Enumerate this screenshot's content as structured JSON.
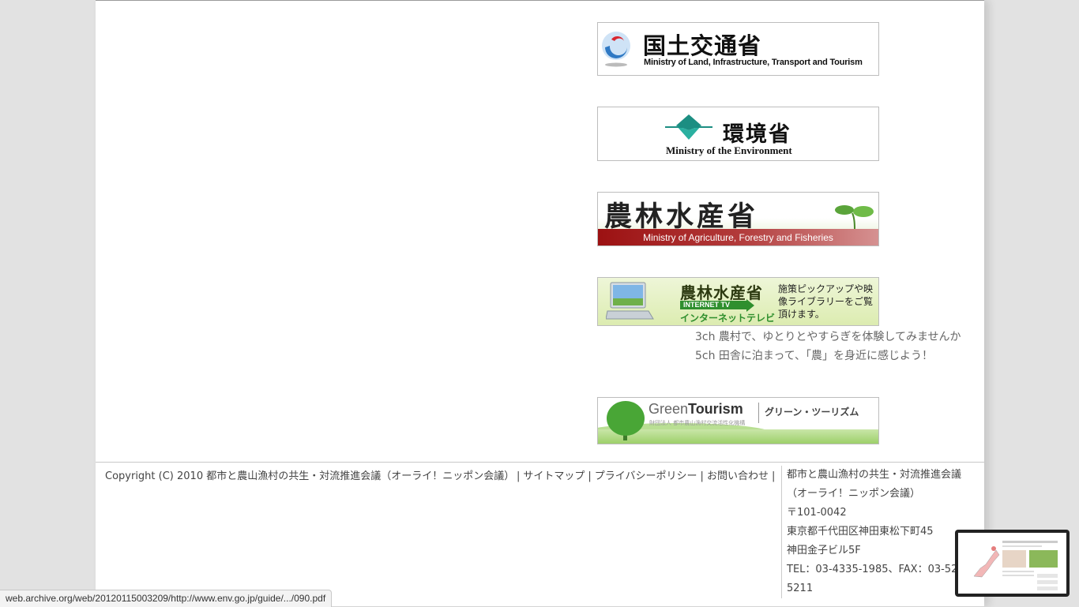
{
  "banners": {
    "mlit": {
      "jp": "国土交通省",
      "en": "Ministry of Land, Infrastructure, Transport and Tourism"
    },
    "env": {
      "jp": "環境省",
      "en": "Ministry of the Environment"
    },
    "maff": {
      "jp": "農林水産省",
      "en": "Ministry of Agriculture, Forestry and Fisheries"
    },
    "maff_tv": {
      "jp": "農林水産省",
      "tv": "INTERNET TV",
      "kana": "インターネットテレビ",
      "desc": "施策ピックアップや映像ライブラリーをご覧頂けます。"
    },
    "green_tourism": {
      "title_light": "Green",
      "title_bold": "Tourism",
      "kana": "グリーン・ツーリズム",
      "sub": "財団法人 都市農山漁村交流活性化機構"
    }
  },
  "channels": [
    "3ch 農村で、ゆとりとやすらぎを体験してみませんか",
    "5ch 田舎に泊まって、「農」を身近に感じよう！"
  ],
  "footer": {
    "copyright": "Copyright (C) 2010 都市と農山漁村の共生・対流推進会議（オーライ！ニッポン会議）",
    "links": [
      "サイトマップ",
      "プライバシーポリシー",
      "お問い合わせ"
    ],
    "address": [
      "都市と農山漁村の共生・対流推進会議",
      "（オーライ！ニッポン会議）",
      "〒101-0042",
      "東京都千代田区神田東松下町45",
      "神田金子ビル5F",
      "TEL：03-4335-1985、FAX：03-52",
      "5211"
    ]
  },
  "status_url": "web.archive.org/web/20120115003209/http://www.env.go.jp/guide/.../090.pdf",
  "colors": {
    "maff_red": "#9c1112",
    "green": "#2f8f2e",
    "page_bg": "#e2e2e2"
  }
}
